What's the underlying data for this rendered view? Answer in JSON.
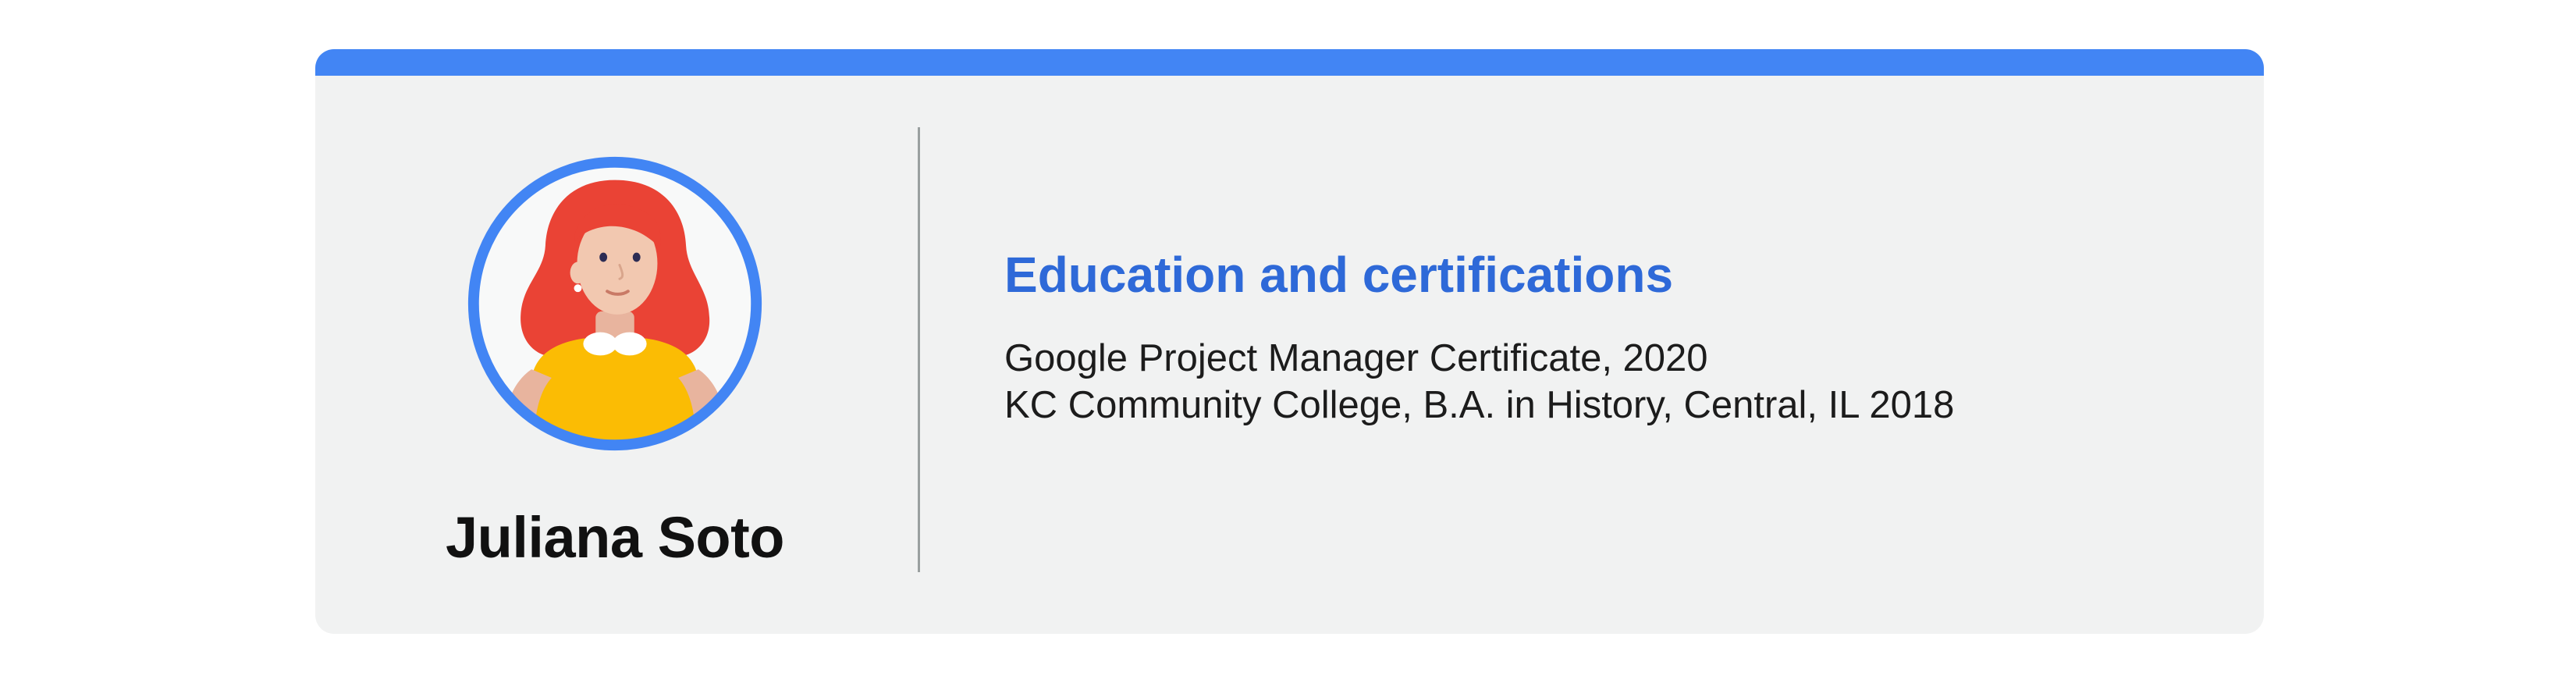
{
  "colors": {
    "accent": "#4285f4",
    "heading": "#2e69d8",
    "card_background": "#f1f2f2",
    "avatar_ring": "#4285f4",
    "hair": "#ea4335",
    "shirt": "#fbbc04"
  },
  "profile": {
    "name": "Juliana Soto",
    "avatar_icon": "person-illustration-icon"
  },
  "education": {
    "heading": "Education and certifications",
    "entries": [
      "Google Project Manager Certificate, 2020",
      "KC Community College, B.A. in History, Central, IL 2018"
    ]
  }
}
